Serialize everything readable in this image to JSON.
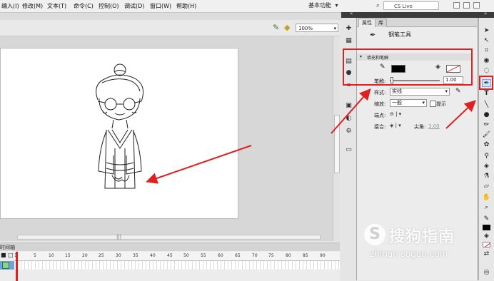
{
  "menu": {
    "items": [
      "编入(I)",
      "修改(M)",
      "文本(T)",
      "命令(C)",
      "控制(O)",
      "调试(D)",
      "窗口(W)",
      "帮助(H)"
    ],
    "workspace": "基本功能",
    "search_placeholder": "CS Live"
  },
  "stage": {
    "zoom": "100%"
  },
  "timeline": {
    "header": "时间轴",
    "ticks": [
      "1",
      "5",
      "10",
      "15",
      "20",
      "25",
      "30",
      "35",
      "40",
      "45",
      "50",
      "55",
      "60",
      "65",
      "70",
      "75",
      "80",
      "85",
      "90"
    ]
  },
  "properties": {
    "tabs": [
      "属性",
      "库"
    ],
    "tool_name": "钢笔工具",
    "section_title": "填充和笔触",
    "stroke_label": "笔触:",
    "stroke_value": "1.00",
    "style_label": "样式:",
    "style_value": "实线",
    "scale_label": "缩放:",
    "scale_value": "一般",
    "hint_label": "提示",
    "cap_label": "端点:",
    "join_label": "接合:",
    "miter_label": "尖角:",
    "miter_value": "3.00",
    "stroke_color": "#000000",
    "fill_color": "none"
  },
  "watermark": {
    "brand": "搜狗指南",
    "url": "zhinan.sogou.com"
  },
  "colors": {
    "annotation_red": "#e02020"
  }
}
